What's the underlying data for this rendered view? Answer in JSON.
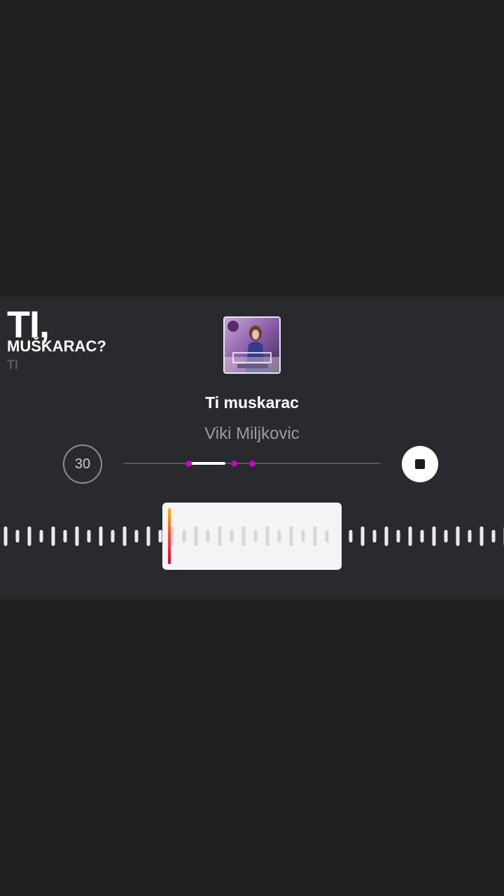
{
  "lyrics": {
    "line1": "TI,",
    "line2": "MUŠKARAC?",
    "line3": "TI"
  },
  "track": {
    "title": "Ti muskarac",
    "artist": "Viki Miljkovic",
    "cover_icon": "album-cover"
  },
  "controls": {
    "duration_label": "30",
    "stop_icon": "stop-icon",
    "progress_fraction": 0.26
  },
  "colors": {
    "background": "#212121",
    "panel": "#282a2e",
    "marker": "#c400c4",
    "playhead": "#ff4d2e"
  }
}
